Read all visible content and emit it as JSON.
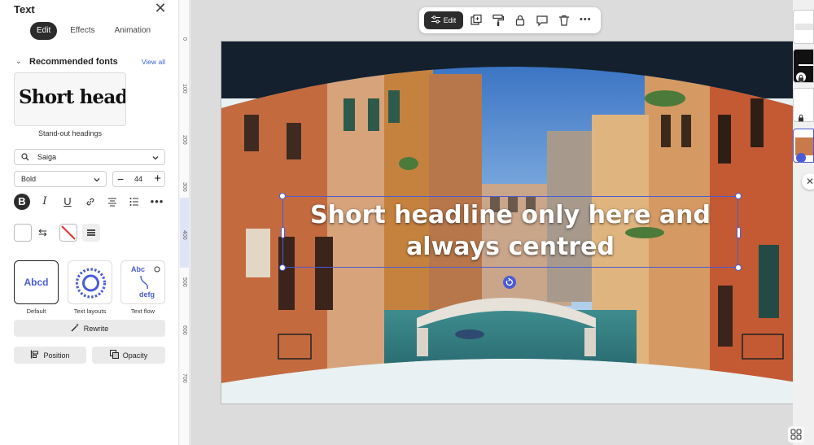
{
  "panel": {
    "title": "Text",
    "tabs": [
      {
        "label": "Edit",
        "active": true
      },
      {
        "label": "Effects",
        "active": false
      },
      {
        "label": "Animation",
        "active": false
      }
    ],
    "recommended": {
      "title": "Recommended fonts",
      "view_all": "View all",
      "card_text": "Short head",
      "card_caption": "Stand-out headings"
    },
    "font_family": "Saiga",
    "font_weight": "Bold",
    "font_size": "44",
    "format_icons": [
      "bold-icon",
      "italic-icon",
      "underline-icon",
      "link-icon",
      "align-center-icon",
      "list-icon",
      "more-icon"
    ],
    "tiles": [
      {
        "label": "Default",
        "preview": "Abcd"
      },
      {
        "label": "Text layouts",
        "preview": "ABCDEFGHIJK"
      },
      {
        "label": "Text flow",
        "preview_top": "Abc",
        "preview_bottom": "defg"
      }
    ],
    "rewrite_label": "Rewrite",
    "position_label": "Position",
    "opacity_label": "Opacity"
  },
  "ruler": {
    "labels": [
      "0",
      "100",
      "200",
      "300",
      "400",
      "500",
      "600",
      "700"
    ]
  },
  "toolbar": {
    "edit_label": "Edit"
  },
  "canvas": {
    "headline": "Short headline only here and always centred"
  },
  "colors": {
    "accent": "#4a5bd6",
    "dark": "#2c2c2c",
    "link": "#3b63d9"
  }
}
